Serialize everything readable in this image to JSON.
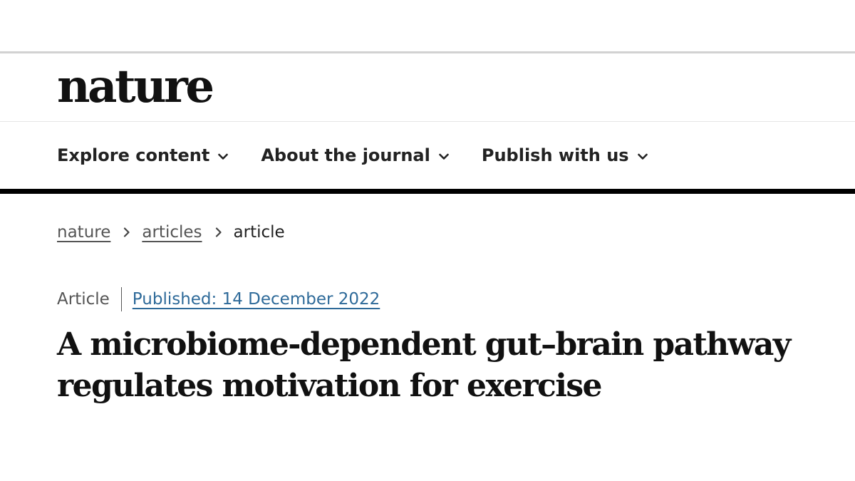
{
  "brand": {
    "logo_text": "nature"
  },
  "nav": {
    "items": [
      {
        "label": "Explore content",
        "icon": "chevron-down-icon"
      },
      {
        "label": "About the journal",
        "icon": "chevron-down-icon"
      },
      {
        "label": "Publish with us",
        "icon": "chevron-down-icon"
      }
    ]
  },
  "breadcrumb": {
    "items": [
      {
        "label": "nature",
        "link": true
      },
      {
        "label": "articles",
        "link": true
      },
      {
        "label": "article",
        "link": false
      }
    ],
    "separator_icon": "chevron-right-icon"
  },
  "article": {
    "type": "Article",
    "published": "Published: 14 December 2022",
    "title": "A microbiome-dependent gut–brain pathway regulates motivation for exercise"
  },
  "colors": {
    "text": "#222222",
    "link_blue": "#2e6a99",
    "muted": "#555555",
    "rule_black": "#000000",
    "rule_gray": "#d2d2d2"
  }
}
